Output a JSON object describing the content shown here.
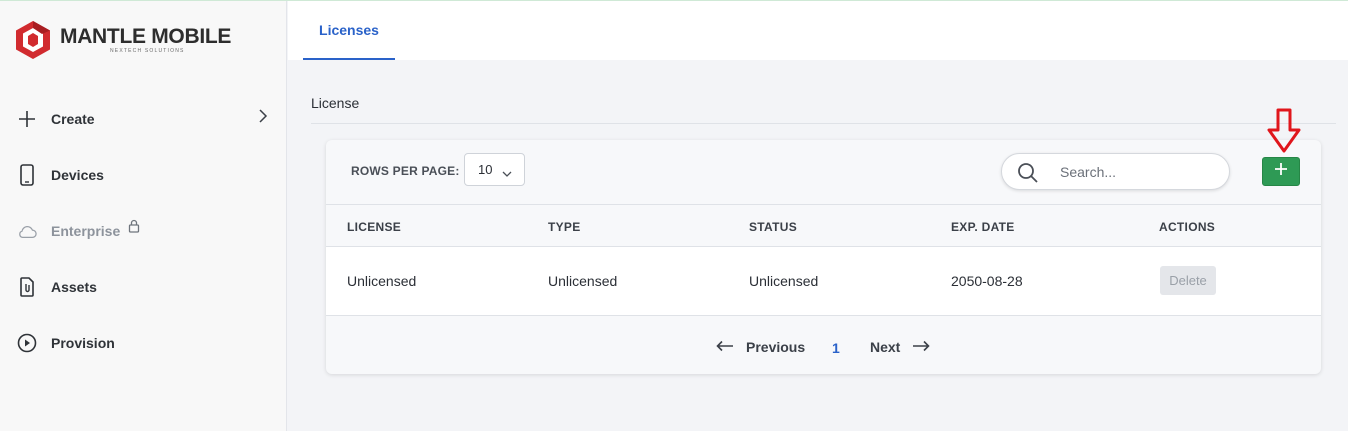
{
  "brand": {
    "name": "MANTLE MOBILE",
    "tagline": "NEXTECH SOLUTIONS",
    "logo_color": "#d12b2f"
  },
  "sidebar": {
    "items": [
      {
        "label": "Create",
        "icon": "plus-icon",
        "has_submenu": true
      },
      {
        "label": "Devices",
        "icon": "phone-icon"
      },
      {
        "label": "Enterprise",
        "icon": "cloud-icon",
        "disabled": true,
        "locked": true
      },
      {
        "label": "Assets",
        "icon": "file-attachment-icon"
      },
      {
        "label": "Provision",
        "icon": "play-circle-icon"
      }
    ]
  },
  "tabs": [
    {
      "label": "Licenses",
      "active": true
    }
  ],
  "section": {
    "title": "License"
  },
  "toolbar": {
    "rows_per_page_label": "ROWS PER PAGE:",
    "rows_per_page_value": "10",
    "search_placeholder": "Search...",
    "add_button_icon": "plus-icon"
  },
  "table": {
    "columns": [
      "LICENSE",
      "TYPE",
      "STATUS",
      "EXP. DATE",
      "ACTIONS"
    ],
    "rows": [
      {
        "license": "Unlicensed",
        "type": "Unlicensed",
        "status": "Unlicensed",
        "exp_date": "2050-08-28",
        "action": "Delete"
      }
    ]
  },
  "pagination": {
    "previous": "Previous",
    "current_page": "1",
    "next": "Next"
  },
  "colors": {
    "accent": "#2a62c9",
    "add_button": "#2e9a55",
    "annotation_arrow": "#e0161c"
  }
}
